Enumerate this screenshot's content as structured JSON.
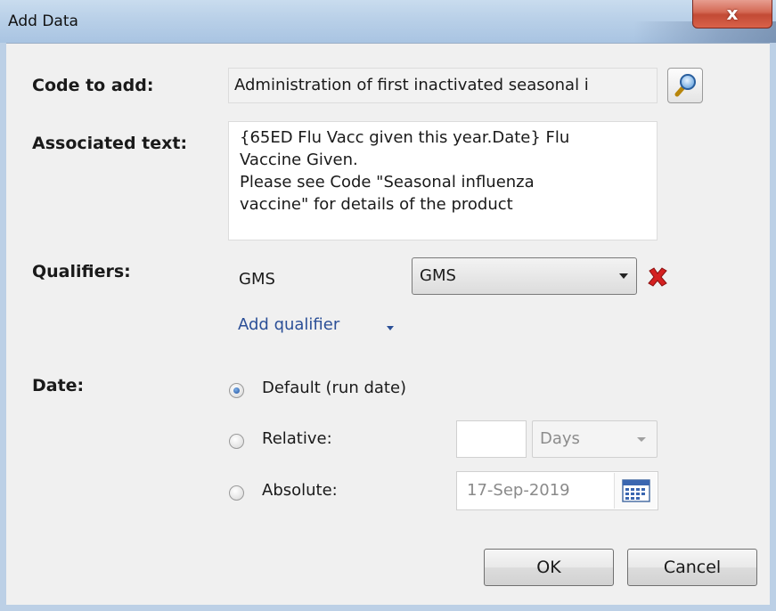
{
  "window": {
    "title": "Add Data",
    "close_glyph": "x"
  },
  "code": {
    "label": "Code to add:",
    "value": "Administration of first inactivated seasonal i",
    "search_icon": "magnifier-icon"
  },
  "associated": {
    "label": "Associated text:",
    "value": "{65ED Flu Vacc given this year.Date} Flu\nVaccine Given.\nPlease see Code \"Seasonal influenza\nvaccine\" for details of the product"
  },
  "qualifiers": {
    "label": "Qualifiers:",
    "items": [
      {
        "name": "GMS",
        "selected": "GMS"
      }
    ],
    "add_label": "Add qualifier",
    "remove_color": "#d42020"
  },
  "date": {
    "label": "Date:",
    "options": [
      {
        "label": "Default (run date)",
        "checked": true
      },
      {
        "label": "Relative:",
        "checked": false
      },
      {
        "label": "Absolute:",
        "checked": false
      }
    ],
    "relative_value": "",
    "relative_unit": "Days",
    "absolute_value": "17-Sep-2019"
  },
  "buttons": {
    "ok": "OK",
    "cancel": "Cancel"
  }
}
